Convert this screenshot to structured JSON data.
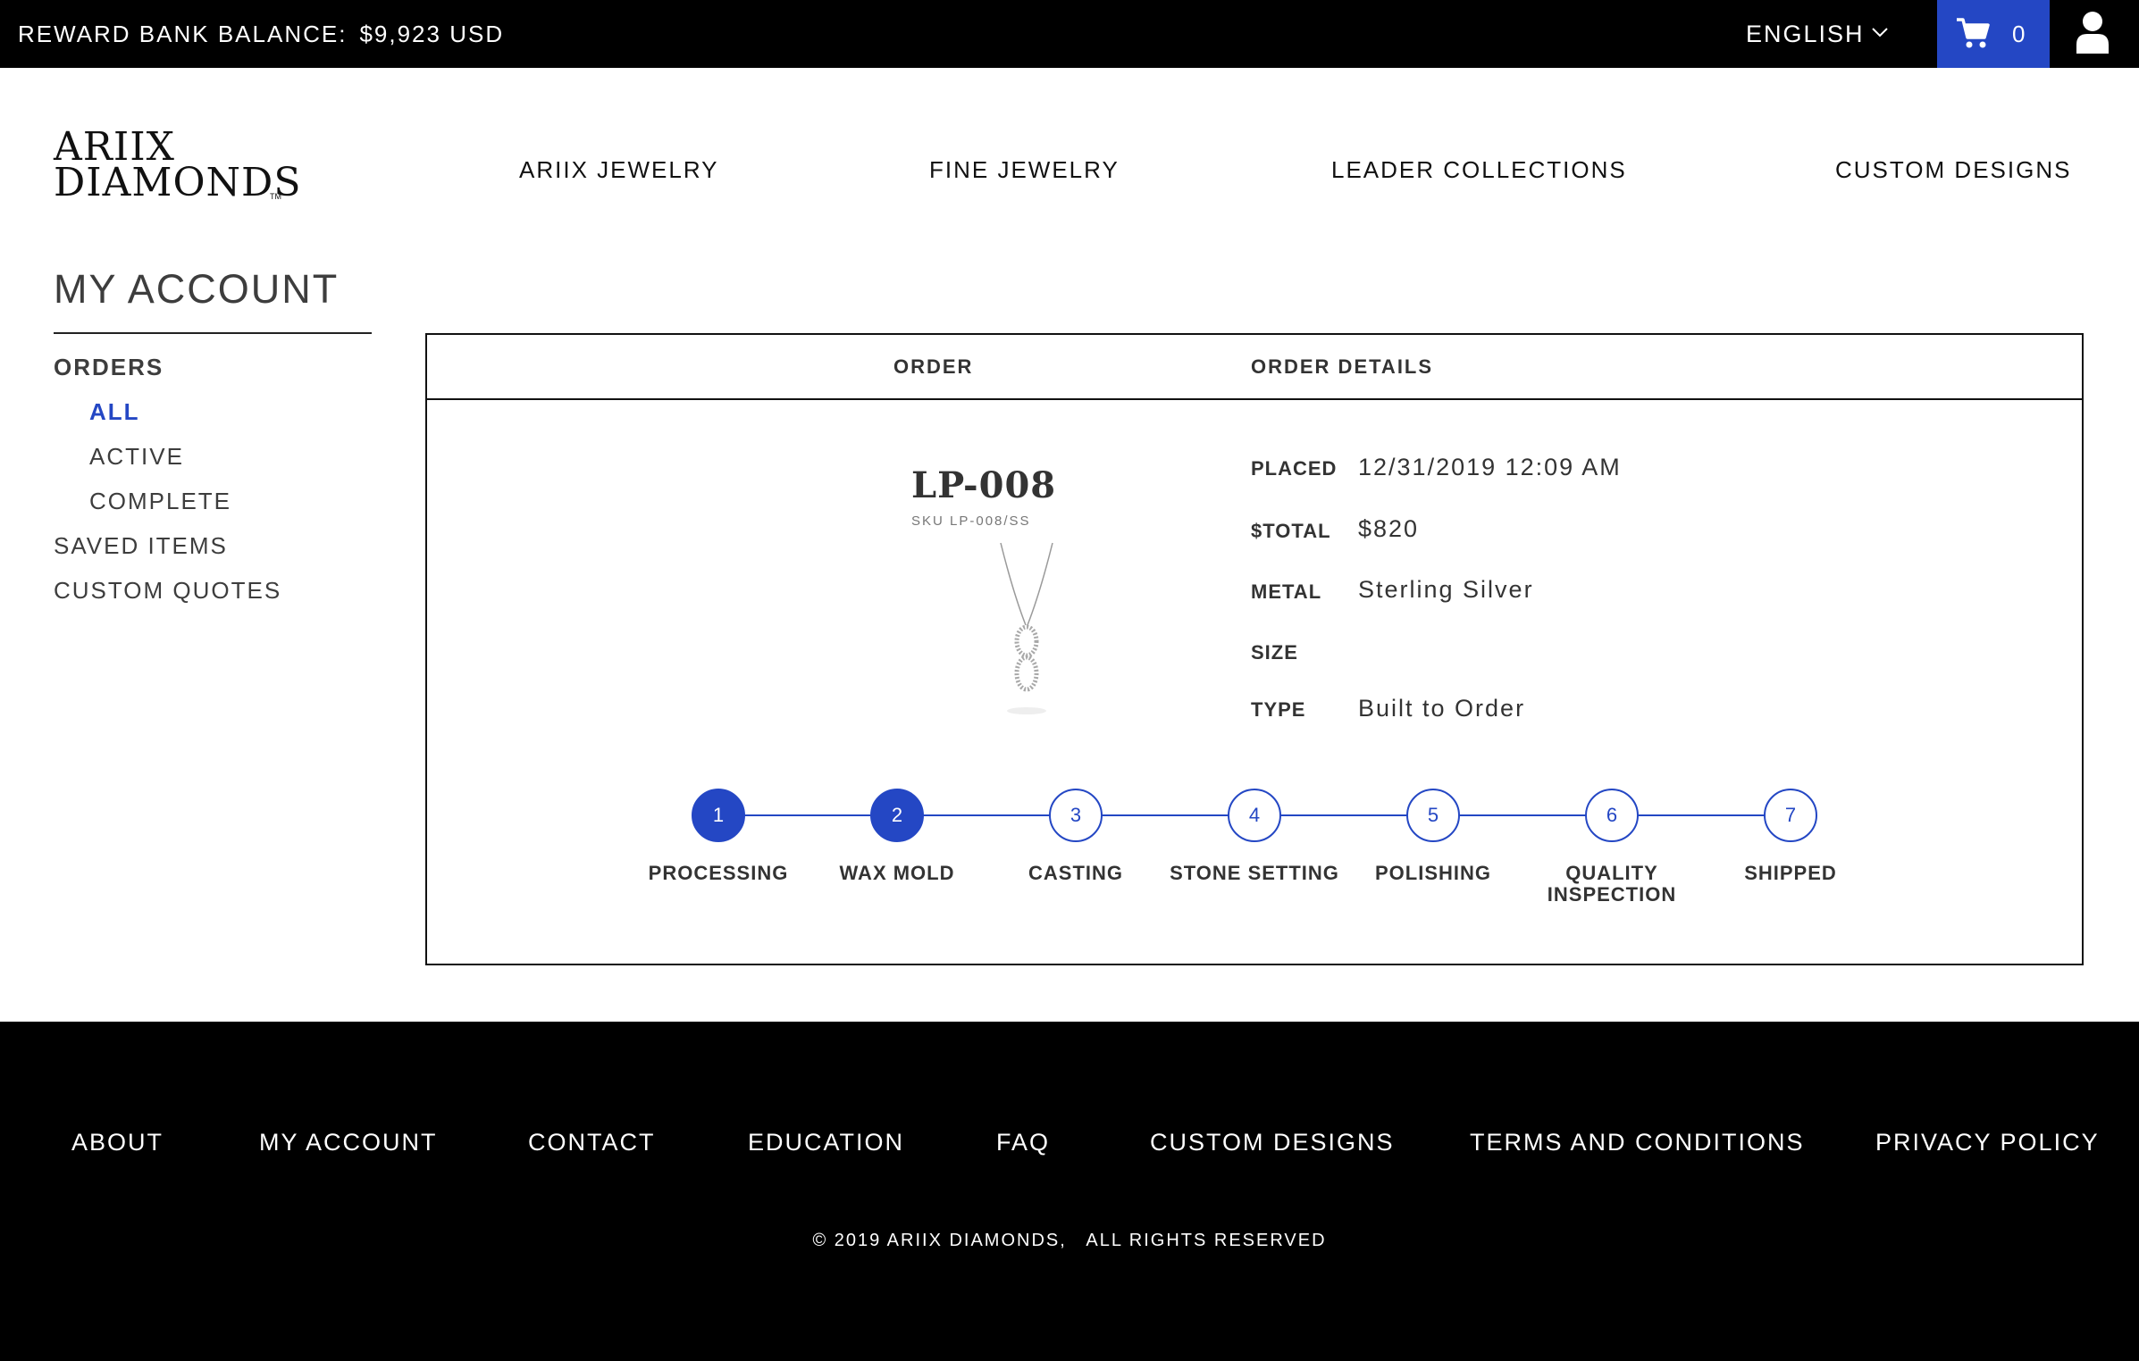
{
  "topbar": {
    "reward_label": "REWARD BANK BALANCE:",
    "reward_value": "$9,923 USD",
    "language": "ENGLISH",
    "cart_count": "0"
  },
  "brand": {
    "line1": "ARIIX",
    "line2": "DIAMONDS",
    "tm": "TM"
  },
  "nav": [
    "ARIIX JEWELRY",
    "FINE JEWELRY",
    "LEADER COLLECTIONS",
    "CUSTOM DESIGNS"
  ],
  "sidebar": {
    "title": "MY ACCOUNT",
    "orders": "ORDERS",
    "sub": [
      "ALL",
      "ACTIVE",
      "COMPLETE"
    ],
    "saved": "SAVED ITEMS",
    "quotes": "CUSTOM QUOTES"
  },
  "order": {
    "col_order": "ORDER",
    "col_details": "ORDER DETAILS",
    "name": "LP-008",
    "sku": "SKU LP-008/SS",
    "details": [
      {
        "label": "PLACED",
        "value": "12/31/2019 12:09 AM"
      },
      {
        "label": "$TOTAL",
        "value": "$820"
      },
      {
        "label": "METAL",
        "value": "Sterling Silver"
      },
      {
        "label": "SIZE",
        "value": ""
      },
      {
        "label": "TYPE",
        "value": "Built to Order"
      }
    ],
    "steps": [
      {
        "num": "1",
        "label": "PROCESSING",
        "done": true
      },
      {
        "num": "2",
        "label": "WAX MOLD",
        "done": true
      },
      {
        "num": "3",
        "label": "CASTING",
        "done": false
      },
      {
        "num": "4",
        "label": "STONE SETTING",
        "done": false
      },
      {
        "num": "5",
        "label": "POLISHING",
        "done": false
      },
      {
        "num": "6",
        "label": "QUALITY INSPECTION",
        "done": false
      },
      {
        "num": "7",
        "label": "SHIPPED",
        "done": false
      }
    ]
  },
  "footer": {
    "links": [
      "ABOUT",
      "MY ACCOUNT",
      "CONTACT",
      "EDUCATION",
      "FAQ",
      "CUSTOM DESIGNS",
      "TERMS AND CONDITIONS",
      "PRIVACY POLICY"
    ],
    "copyright": "© 2019 ARIIX DIAMONDS,   ALL RIGHTS RESERVED"
  },
  "colors": {
    "accent": "#2447c4",
    "bar": "#000000",
    "text": "#333333"
  },
  "icons": [
    "chevron-down-icon",
    "cart-icon",
    "user-icon",
    "pendant-image"
  ]
}
